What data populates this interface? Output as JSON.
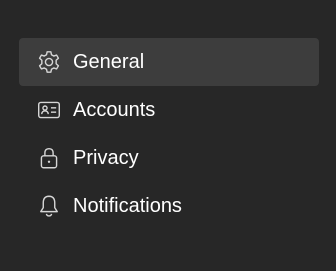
{
  "colors": {
    "background": "#272727",
    "selected_background": "#3d3d3d",
    "text": "#ffffff",
    "icon": "#d6d6d6"
  },
  "nav": {
    "items": [
      {
        "label": "General",
        "icon": "gear-icon",
        "selected": true
      },
      {
        "label": "Accounts",
        "icon": "id-card-icon",
        "selected": false
      },
      {
        "label": "Privacy",
        "icon": "lock-icon",
        "selected": false
      },
      {
        "label": "Notifications",
        "icon": "bell-icon",
        "selected": false
      }
    ]
  }
}
